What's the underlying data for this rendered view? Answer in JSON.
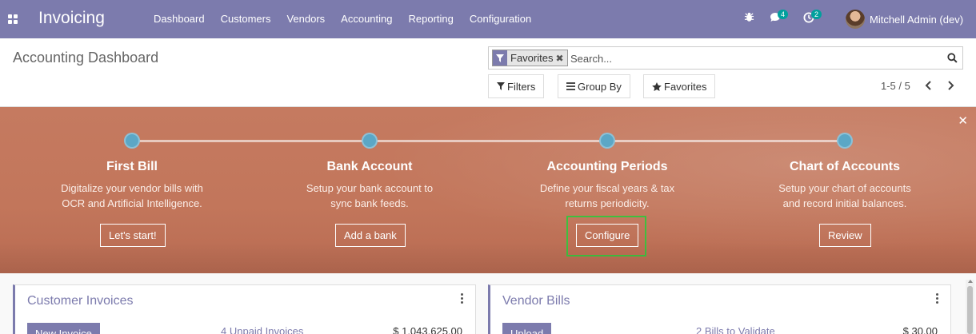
{
  "navbar": {
    "app_name": "Invoicing",
    "menu": [
      "Dashboard",
      "Customers",
      "Vendors",
      "Accounting",
      "Reporting",
      "Configuration"
    ],
    "messages_count": "4",
    "activities_count": "2",
    "user_name": "Mitchell Admin (dev)"
  },
  "control_panel": {
    "title": "Accounting Dashboard",
    "facet_label": "Favorites",
    "search_placeholder": "Search...",
    "filters_label": "Filters",
    "groupby_label": "Group By",
    "favorites_label": "Favorites",
    "pager": "1-5 / 5"
  },
  "onboarding": {
    "steps": [
      {
        "title": "First Bill",
        "description": "Digitalize your vendor bills with OCR and Artificial Intelligence.",
        "button": "Let's start!"
      },
      {
        "title": "Bank Account",
        "description": "Setup your bank account to sync bank feeds.",
        "button": "Add a bank"
      },
      {
        "title": "Accounting Periods",
        "description": "Define your fiscal years & tax returns periodicity.",
        "button": "Configure"
      },
      {
        "title": "Chart of Accounts",
        "description": "Setup your chart of accounts and record initial balances.",
        "button": "Review"
      }
    ],
    "colors": {
      "banner": "#c2765b",
      "dot": "#5ba7c6",
      "highlight": "#3fbf3f"
    }
  },
  "cards": [
    {
      "title": "Customer Invoices",
      "primary_button": "New Invoice",
      "link": "4 Unpaid Invoices",
      "amount": "$ 1,043,625.00"
    },
    {
      "title": "Vendor Bills",
      "primary_button": "Upload",
      "link": "2 Bills to Validate",
      "amount": "$ 30.00"
    }
  ],
  "theme": {
    "primary": "#7c7bad"
  }
}
